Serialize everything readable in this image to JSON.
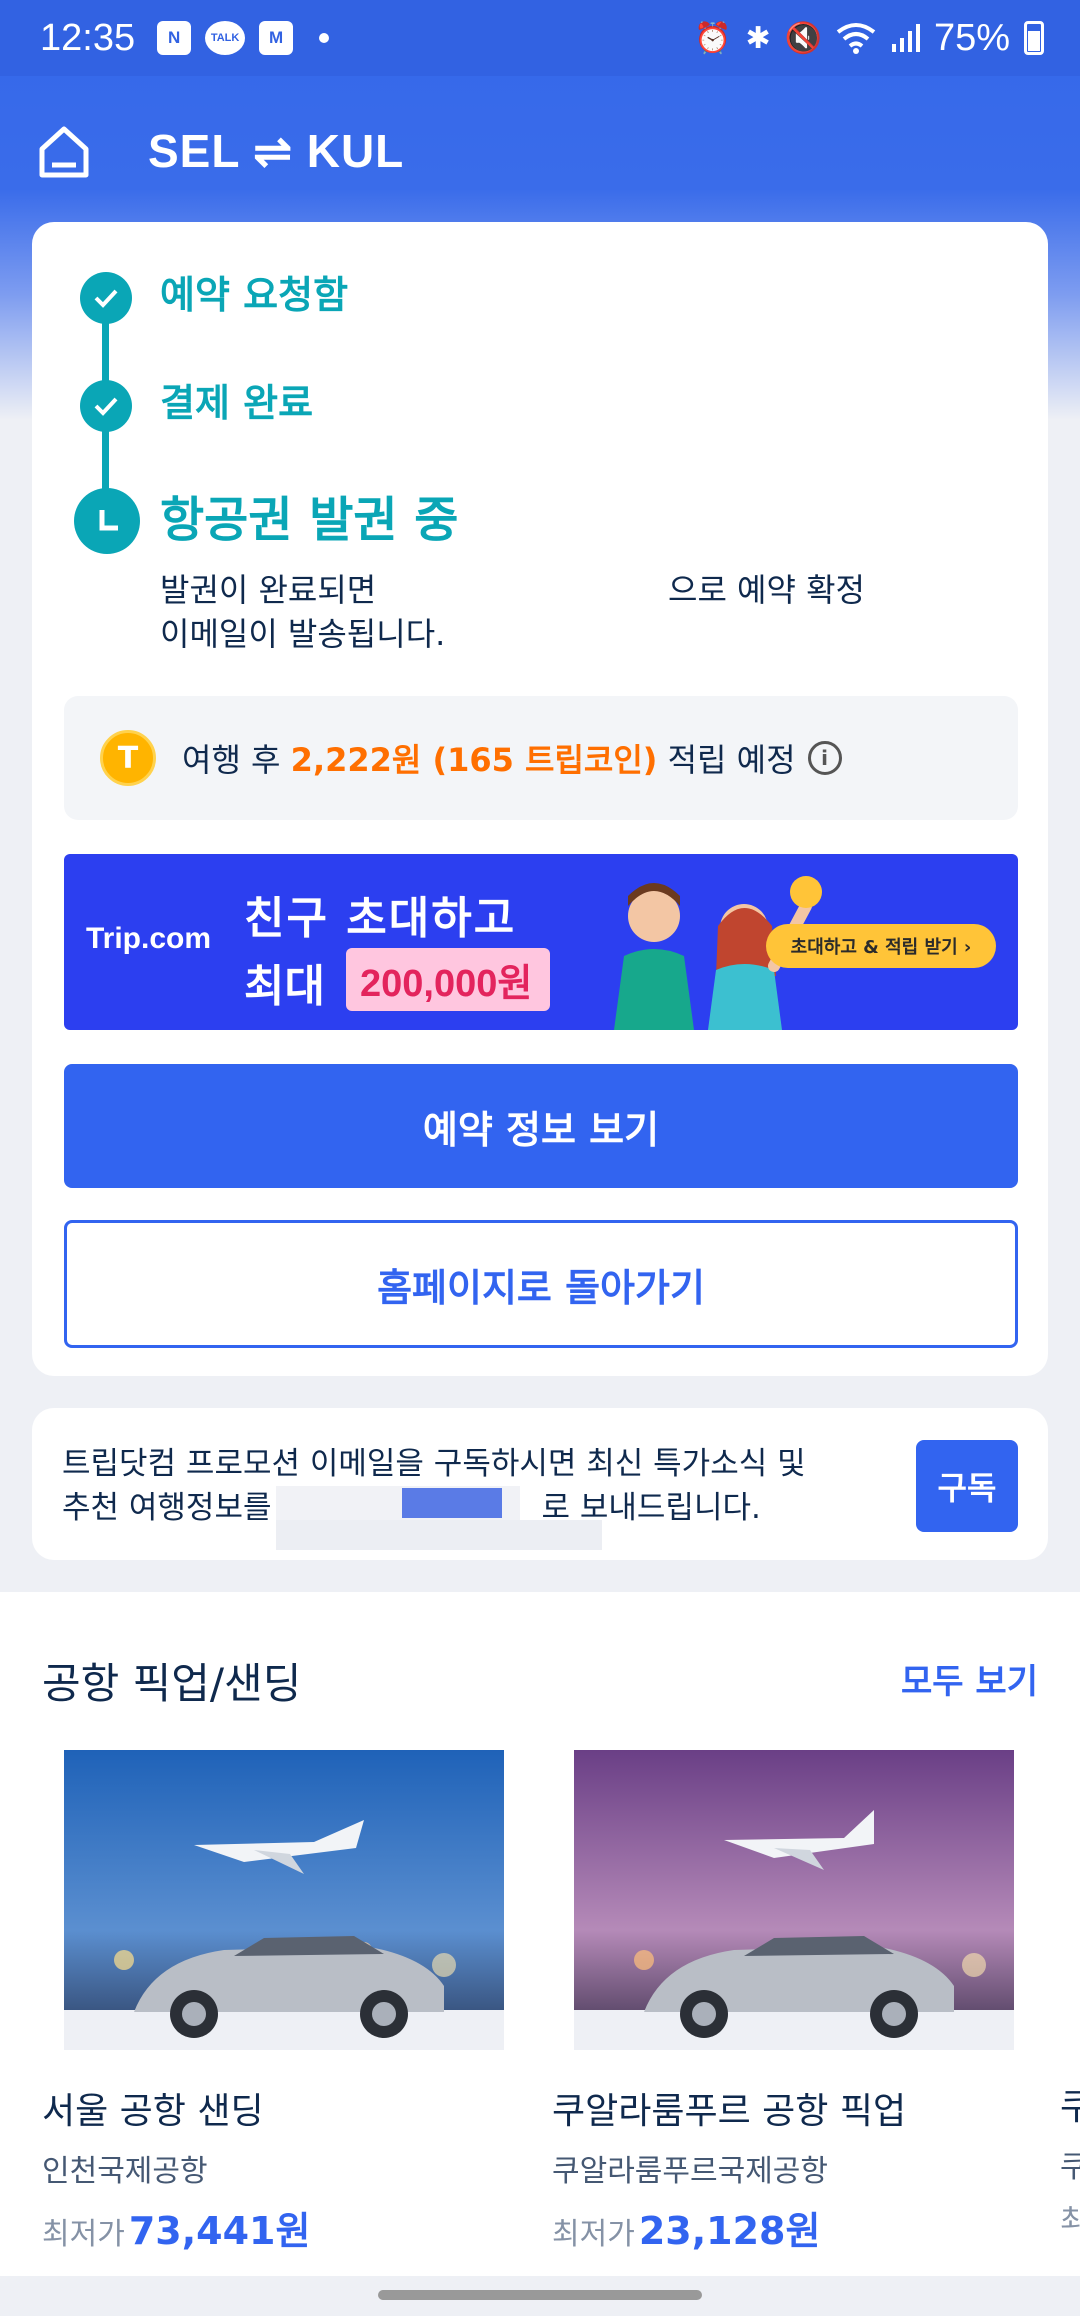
{
  "status_bar": {
    "time": "12:35",
    "apps": [
      "N",
      "TALK",
      "M"
    ],
    "battery": "75%"
  },
  "header": {
    "route": "SEL ⇌ KUL"
  },
  "steps": [
    {
      "label": "예약 요청함",
      "state": "done"
    },
    {
      "label": "결제 완료",
      "state": "done"
    },
    {
      "label": "항공권 발권 중",
      "state": "current"
    }
  ],
  "step_desc": {
    "line1": "발권이 완료되면",
    "line1_right": "으로 예약 확정",
    "line2": "이메일이 발송됩니다."
  },
  "coin": {
    "icon": "T",
    "prefix": "여행 후 ",
    "amount": "2,222원 (165 트립코인)",
    "suffix": " 적립 예정"
  },
  "banner": {
    "logo": "Trip.com",
    "line1": "친구 초대하고",
    "line2": "최대",
    "amount": "200,000원",
    "button": "초대하고 & 적립 받기 ›"
  },
  "buttons": {
    "view_booking": "예약 정보 보기",
    "go_home": "홈페이지로 돌아가기"
  },
  "subscribe": {
    "text_line1": "트립닷컴 프로모션 이메일을 구독하시면 최신 특가소식 및",
    "text_line2_a": "추천 여행정보를",
    "text_line2_b": "로 보내드립니다.",
    "button": "구독"
  },
  "pickup": {
    "title": "공항 픽업/샌딩",
    "view_all": "모두 보기",
    "price_label": "최저가",
    "items": [
      {
        "name": "서울 공항 샌딩",
        "airport": "인천국제공항",
        "price": "73,441원"
      },
      {
        "name": "쿠알라룸푸르 공항 픽업",
        "airport": "쿠알라룸푸르국제공항",
        "price": "23,128원"
      },
      {
        "name": "쿠",
        "airport": "쿠",
        "price": ""
      }
    ]
  },
  "colors": {
    "brand_blue": "#3264f0",
    "teal": "#0aa6b6",
    "orange": "#ff6f00"
  }
}
